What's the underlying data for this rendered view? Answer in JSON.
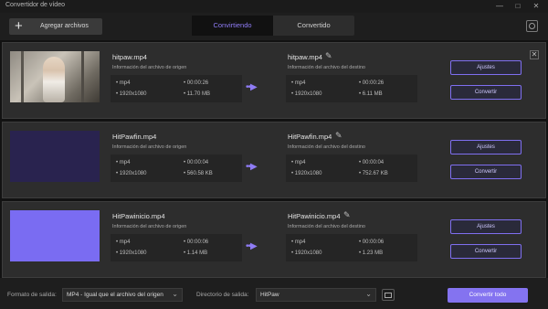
{
  "window": {
    "title": "Convertidor de vídeo",
    "controls": [
      "minimize-icon",
      "maximize-icon",
      "close-icon"
    ]
  },
  "toolbar": {
    "add_label": "Agregar archivos",
    "tabs": [
      {
        "label": "Convirtiendo",
        "active": true
      },
      {
        "label": "Convertido",
        "active": false
      }
    ]
  },
  "theme": {
    "accent": "#8473f0",
    "background": "#1e1e1e",
    "card": "#2d2d2d"
  },
  "files": [
    {
      "thumbnail": "photo",
      "source_name": "hitpaw.mp4",
      "source_info_label": "Información del archivo de origen",
      "source": {
        "format": "mp4",
        "duration": "00:00:26",
        "resolution": "1920x1080",
        "size": "11.70 MB"
      },
      "dest_name": "hitpaw.mp4",
      "dest_info_label": "Información del archivo del destino",
      "dest": {
        "format": "mp4",
        "duration": "00:00:26",
        "resolution": "1920x1080",
        "size": "6.11 MB"
      },
      "settings_label": "Ajustes",
      "convert_label": "Convertir"
    },
    {
      "thumbnail": "dark",
      "source_name": "HitPawfin.mp4",
      "source_info_label": "Información del archivo de origen",
      "source": {
        "format": "mp4",
        "duration": "00:00:04",
        "resolution": "1920x1080",
        "size": "560.58 KB"
      },
      "dest_name": "HitPawfin.mp4",
      "dest_info_label": "Información del archivo del destino",
      "dest": {
        "format": "mp4",
        "duration": "00:00:04",
        "resolution": "1920x1080",
        "size": "752.67 KB"
      },
      "settings_label": "Ajustes",
      "convert_label": "Convertir"
    },
    {
      "thumbnail": "purple",
      "source_name": "HitPawinicio.mp4",
      "source_info_label": "Información del archivo de origen",
      "source": {
        "format": "mp4",
        "duration": "00:00:06",
        "resolution": "1920x1080",
        "size": "1.14 MB"
      },
      "dest_name": "HitPawinicio.mp4",
      "dest_info_label": "Información del archivo del destino",
      "dest": {
        "format": "mp4",
        "duration": "00:00:06",
        "resolution": "1920x1080",
        "size": "1.23 MB"
      },
      "settings_label": "Ajustes",
      "convert_label": "Convertir"
    }
  ],
  "footer": {
    "format_label": "Formato de salida:",
    "format_value": "MP4 - Igual que el archivo del origen",
    "dir_label": "Directorio de salida:",
    "dir_value": "HitPaw",
    "convert_all_label": "Convertir todo"
  }
}
